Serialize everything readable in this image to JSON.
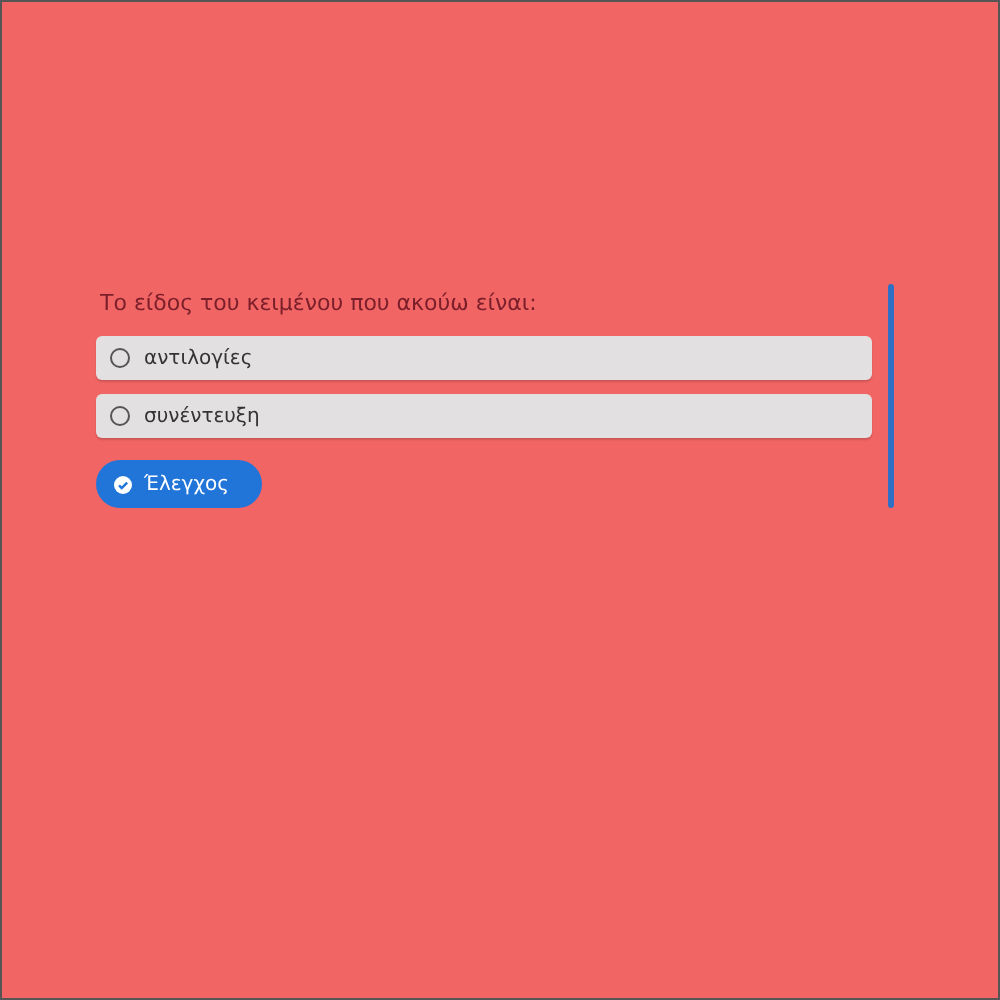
{
  "question": "Το είδος του κειμένου που ακούω είναι:",
  "options": [
    {
      "label": "αντιλογίες",
      "selected": false
    },
    {
      "label": "συνέντευξη",
      "selected": false
    }
  ],
  "check_button": {
    "label": "Έλεγχος"
  }
}
